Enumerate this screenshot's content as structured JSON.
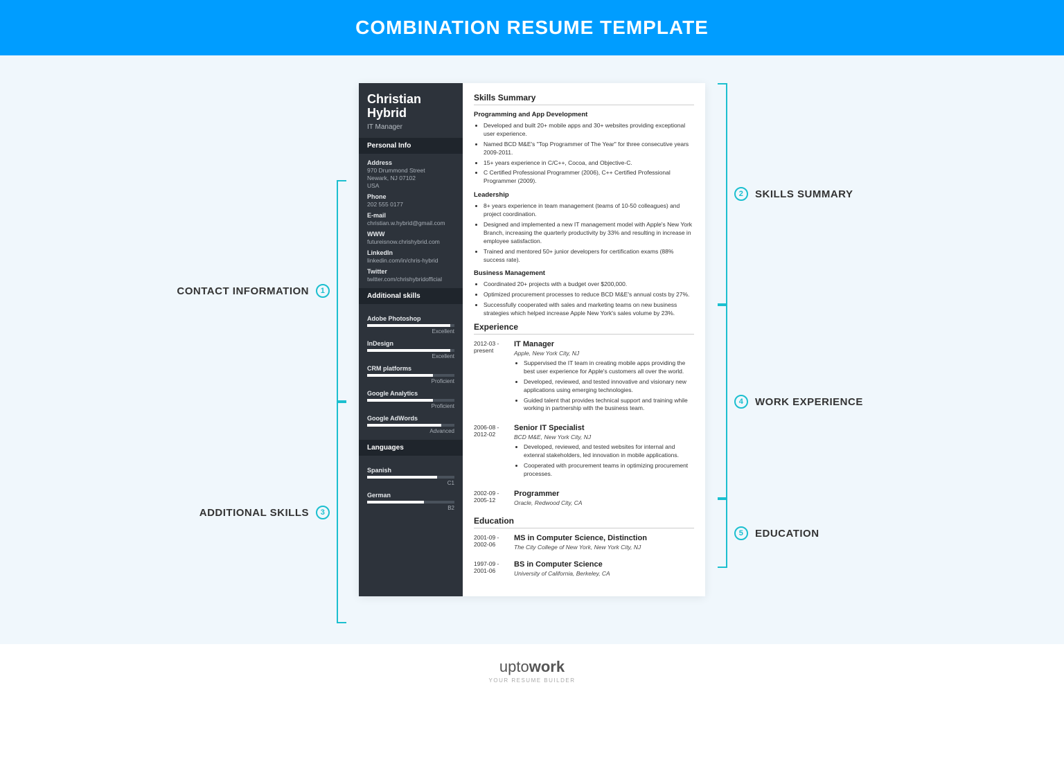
{
  "banner": "COMBINATION RESUME TEMPLATE",
  "callouts": {
    "left": [
      {
        "num": "1",
        "text": "CONTACT INFORMATION"
      },
      {
        "num": "3",
        "text": "ADDITIONAL SKILLS"
      }
    ],
    "right": [
      {
        "num": "2",
        "text": "SKILLS SUMMARY"
      },
      {
        "num": "4",
        "text": "WORK EXPERIENCE"
      },
      {
        "num": "5",
        "text": "EDUCATION"
      }
    ]
  },
  "resume": {
    "name_first": "Christian",
    "name_last": "Hybrid",
    "role": "IT Manager",
    "personal_h": "Personal Info",
    "contacts": [
      {
        "label": "Address",
        "lines": [
          "970 Drummond Street",
          "Newark, NJ 07102",
          "USA"
        ]
      },
      {
        "label": "Phone",
        "lines": [
          "202 555 0177"
        ]
      },
      {
        "label": "E-mail",
        "lines": [
          "christian.w.hybrid@gmail.com"
        ]
      },
      {
        "label": "WWW",
        "lines": [
          "futureisnow.chrishybrid.com"
        ]
      },
      {
        "label": "LinkedIn",
        "lines": [
          "linkedin.com/in/chris-hybrid"
        ]
      },
      {
        "label": "Twitter",
        "lines": [
          "twitter.com/chrishybridofficial"
        ]
      }
    ],
    "skills_h": "Additional skills",
    "skills": [
      {
        "name": "Adobe Photoshop",
        "level": "Excellent",
        "pct": 95
      },
      {
        "name": "InDesign",
        "level": "Excellent",
        "pct": 95
      },
      {
        "name": "CRM platforms",
        "level": "Proficient",
        "pct": 75
      },
      {
        "name": "Google Analytics",
        "level": "Proficient",
        "pct": 75
      },
      {
        "name": "Google AdWords",
        "level": "Advanced",
        "pct": 85
      }
    ],
    "lang_h": "Languages",
    "languages": [
      {
        "name": "Spanish",
        "level": "C1",
        "pct": 80
      },
      {
        "name": "German",
        "level": "B2",
        "pct": 65
      }
    ],
    "summary_h": "Skills Summary",
    "summary_groups": [
      {
        "title": "Programming and App Development",
        "items": [
          "Developed and built 20+ mobile apps and 30+ websites providing exceptional user experience.",
          "Named BCD M&E's \"Top Programmer of The Year\" for three consecutive years 2009-2011.",
          "15+ years experience in C/C++, Cocoa, and Objective-C.",
          "C Certified Professional Programmer (2006), C++ Certified Professional Programmer (2009)."
        ]
      },
      {
        "title": "Leadership",
        "items": [
          "8+ years experience in team management (teams of 10-50 colleagues) and project coordination.",
          "Designed and implemented a new IT management model with Apple's New York Branch, increasing the quarterly productivity by 33% and resulting in increase in employee satisfaction.",
          "Trained and mentored 50+ junior developers for certification exams (88% success rate)."
        ]
      },
      {
        "title": "Business Management",
        "items": [
          "Coordinated 20+ projects with a budget over $200,000.",
          "Optimized procurement processes to reduce BCD M&E's annual costs by 27%.",
          "Successfully cooperated with sales and marketing teams on new business strategies which helped increase Apple New York's sales volume by 23%."
        ]
      }
    ],
    "exp_h": "Experience",
    "experience": [
      {
        "dates": "2012-03 - present",
        "title": "IT Manager",
        "org": "Apple, New York City, NJ",
        "bullets": [
          "Suppervised the IT team in creating mobile apps providing the best user experience for Apple's customers all over the world.",
          "Developed, reviewed, and tested innovative and visionary new applications using emerging technologies.",
          "Guided talent that provides technical support and training while working in partnership with the business team."
        ]
      },
      {
        "dates": "2006-08 - 2012-02",
        "title": "Senior IT Specialist",
        "org": "BCD M&E, New York City, NJ",
        "bullets": [
          "Developed, reviewed, and tested websites for internal and extenral stakeholders, led innovation in mobile applications.",
          "Cooperated with procurement teams in optimizing procurement processes."
        ]
      },
      {
        "dates": "2002-09 - 2005-12",
        "title": "Programmer",
        "org": "Oracle, Redwood City, CA",
        "bullets": []
      }
    ],
    "edu_h": "Education",
    "education": [
      {
        "dates": "2001-09 - 2002-06",
        "title": "MS in Computer Science, Distinction",
        "org": "The City College of New York, New York City, NJ"
      },
      {
        "dates": "1997-09 - 2001-06",
        "title": "BS in Computer Science",
        "org": "University of California, Berkeley, CA"
      }
    ]
  },
  "footer": {
    "brand_a": "upto",
    "brand_b": "work",
    "tag": "YOUR RESUME BUILDER"
  }
}
